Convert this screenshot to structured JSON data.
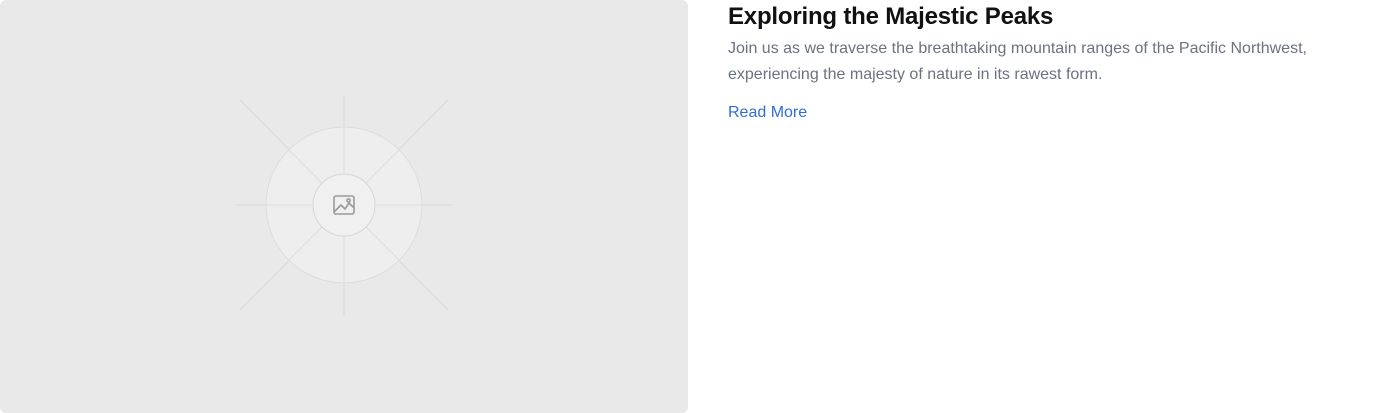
{
  "post": {
    "title": "Exploring the Majestic Peaks",
    "excerpt": "Join us as we traverse the breathtaking mountain ranges of the Pacific Northwest, experiencing the majesty of nature in its rawest form.",
    "read_more_label": "Read More",
    "image_icon": "image-placeholder-icon"
  },
  "colors": {
    "placeholder_bg": "#e9e9e9",
    "title": "#111111",
    "excerpt": "#6b7280",
    "link": "#2f6fd1"
  }
}
